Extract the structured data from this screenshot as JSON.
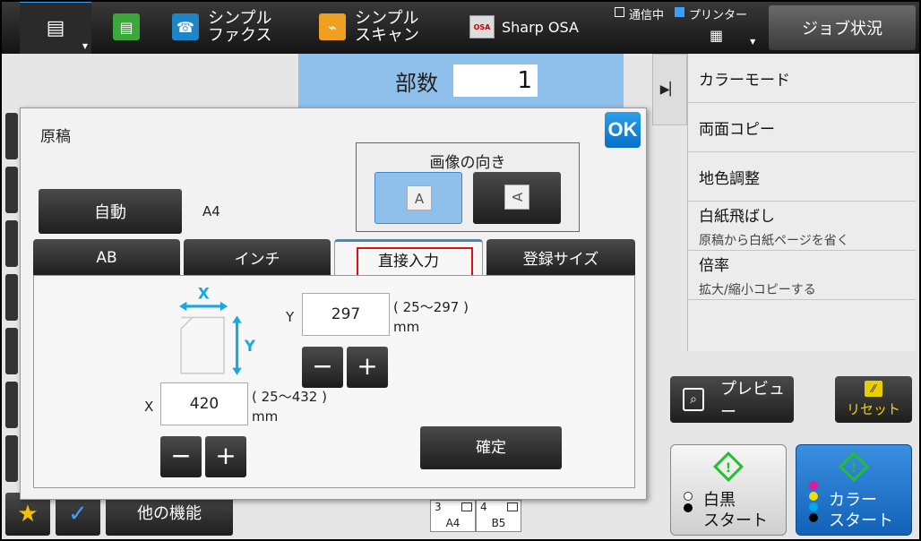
{
  "topbar": {
    "home_icon": "document-stack-icon",
    "copy_icon": "copy-icon",
    "simple_fax": "シンプル\nファクス",
    "simple_scan": "シンプル\nスキャン",
    "sharp_osa": "Sharp OSA",
    "status_comm": "通信中",
    "status_printer": "プリンター",
    "job_status": "ジョブ状況"
  },
  "copies": {
    "label": "部数",
    "value": "1"
  },
  "dialog": {
    "title": "原稿",
    "ok": "OK",
    "auto": "自動",
    "paper_size": "A4",
    "orientation_label": "画像の向き",
    "orientation_glyph": "A",
    "tabs": [
      "AB",
      "インチ",
      "直接入力",
      "登録サイズ"
    ],
    "active_tab": "直接入力",
    "y_label": "Y",
    "y_value": "297",
    "y_range": "( 25～297 )\nmm",
    "x_label": "X",
    "x_value": "420",
    "x_range": "( 25～432 )\nmm",
    "minus": "−",
    "plus": "+",
    "confirm": "確定",
    "diagram_x": "X",
    "diagram_y": "Y"
  },
  "right_panel": {
    "items": [
      {
        "title": "カラーモード",
        "sub": ""
      },
      {
        "title": "両面コピー",
        "sub": ""
      },
      {
        "title": "地色調整",
        "sub": ""
      },
      {
        "title": "白紙飛ばし",
        "sub": "原稿から白紙ページを省く"
      },
      {
        "title": "倍率",
        "sub": "拡大/縮小コピーする"
      }
    ]
  },
  "buttons": {
    "preview": "プレビュー",
    "reset": "リセット",
    "bw_start": "白黒\nスタート",
    "color_start": "カラー\nスタート",
    "other_functions": "他の機能"
  },
  "trays": [
    {
      "num": "3",
      "paper": "A4"
    },
    {
      "num": "4",
      "paper": "B5"
    }
  ],
  "colors": {
    "accent_blue": "#8fc0ec",
    "start_green": "#22c030",
    "reset_yellow": "#e8d000",
    "highlight_red": "#e01010"
  }
}
